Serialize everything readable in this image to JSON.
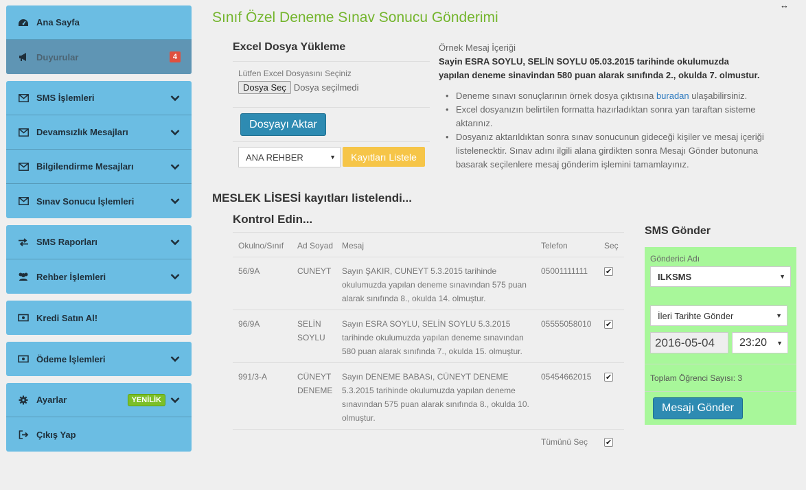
{
  "sidebar": {
    "groups": [
      [
        {
          "label": "Ana Sayfa",
          "icon": "dashboard-icon"
        },
        {
          "label": "Duyurular",
          "icon": "megaphone-icon",
          "badge": "4"
        }
      ],
      [
        {
          "label": "SMS İşlemleri",
          "icon": "envelope-icon"
        },
        {
          "label": "Devamsızlık Mesajları",
          "icon": "envelope-icon"
        },
        {
          "label": "Bilgilendirme Mesajları",
          "icon": "envelope-icon"
        },
        {
          "label": "Sınav Sonucu İşlemleri",
          "icon": "envelope-icon"
        }
      ],
      [
        {
          "label": "SMS Raporları",
          "icon": "exchange-icon"
        },
        {
          "label": "Rehber İşlemleri",
          "icon": "users-icon"
        }
      ],
      [
        {
          "label": "Kredi Satın Al!",
          "icon": "money-icon"
        }
      ],
      [
        {
          "label": "Ödeme İşlemleri",
          "icon": "money-icon"
        }
      ],
      [
        {
          "label": "Ayarlar",
          "icon": "gear-icon",
          "badge": "YENİLİK"
        },
        {
          "label": "Çıkış Yap",
          "icon": "sign-out-icon"
        }
      ]
    ]
  },
  "page": {
    "title": "Sınıf Özel Deneme Sınav Sonucu Gönderimi"
  },
  "upload": {
    "title": "Excel Dosya Yükleme",
    "hint": "Lütfen Excel Dosyasını Seçiniz",
    "file_button": "Dosya Seç",
    "file_none": "Dosya seçilmedi",
    "transfer_button": "Dosyayı Aktar",
    "directory_select": "ANA REHBER",
    "list_button": "Kayıtları Listele"
  },
  "sample": {
    "title": "Örnek Mesaj İçeriği",
    "text": "Sayin ESRA SOYLU, SELİN SOYLU 05.03.2015 tarihinde okulumuzda yapılan deneme sinavindan 580 puan alarak sınıfında 2., okulda 7. olmustur.",
    "bullet1_pre": "Deneme sınavı sonuçlarının örnek dosya çıktısına ",
    "bullet1_link": "buradan",
    "bullet1_post": " ulaşabilirsiniz.",
    "bullet2": "Excel dosyanızın belirtilen formatta hazırladıktan sonra yan taraftan sisteme aktarınız.",
    "bullet3": "Dosyanız aktarıldıktan sonra sınav sonucunun gideceği kişiler ve mesaj içeriği listelenecktir. Sınav adını ilgili alana girdikten sonra Mesajı Gönder butonuna basarak seçilenlere mesaj gönderim işlemini tamamlayınız."
  },
  "results": {
    "listed": "MESLEK LİSESİ kayıtları listelendi...",
    "check": "Kontrol Edin...",
    "columns": [
      "Okulno/Sınıf",
      "Ad Soyad",
      "Mesaj",
      "Telefon",
      "Seç"
    ],
    "rows": [
      {
        "no": "56/9A",
        "name": "CUNEYT",
        "message": "Sayın ŞAKIR, CUNEYT 5.3.2015 tarihinde okulumuzda yapılan deneme sınavından 575 puan alarak sınıfında 8., okulda 14. olmuştur.",
        "phone": "05001111111"
      },
      {
        "no": "96/9A",
        "name": "SELİN SOYLU",
        "message": "Sayın ESRA SOYLU, SELİN SOYLU 5.3.2015 tarihinde okulumuzda yapılan deneme sınavından 580 puan alarak sınıfında 7., okulda 15. olmuştur.",
        "phone": "05555058010"
      },
      {
        "no": "991/3-A",
        "name": "CÜNEYT DENEME",
        "message": "Sayın DENEME BABASı, CÜNEYT DENEME 5.3.2015 tarihinde okulumuzda yapılan deneme sınavından 575 puan alarak sınıfında 8., okulda 10. olmuştur.",
        "phone": "05454662015"
      }
    ],
    "select_all": "Tümünü Seç"
  },
  "sms": {
    "title": "SMS Gönder",
    "sender_label": "Gönderici Adı",
    "sender_value": "ILKSMS",
    "schedule_value": "İleri Tarihte Gönder",
    "date": "2016-05-04",
    "time": "23:20",
    "count": "Toplam Öğrenci Sayısı: 3",
    "send_button": "Mesajı Gönder"
  },
  "colors": {
    "sidebar": "#6bbde3",
    "active": "#5f95b4",
    "title_green": "#74b52d",
    "sms_panel": "#a8f79a",
    "primary_button": "#2e8bb2",
    "warning_button": "#f6c548"
  }
}
